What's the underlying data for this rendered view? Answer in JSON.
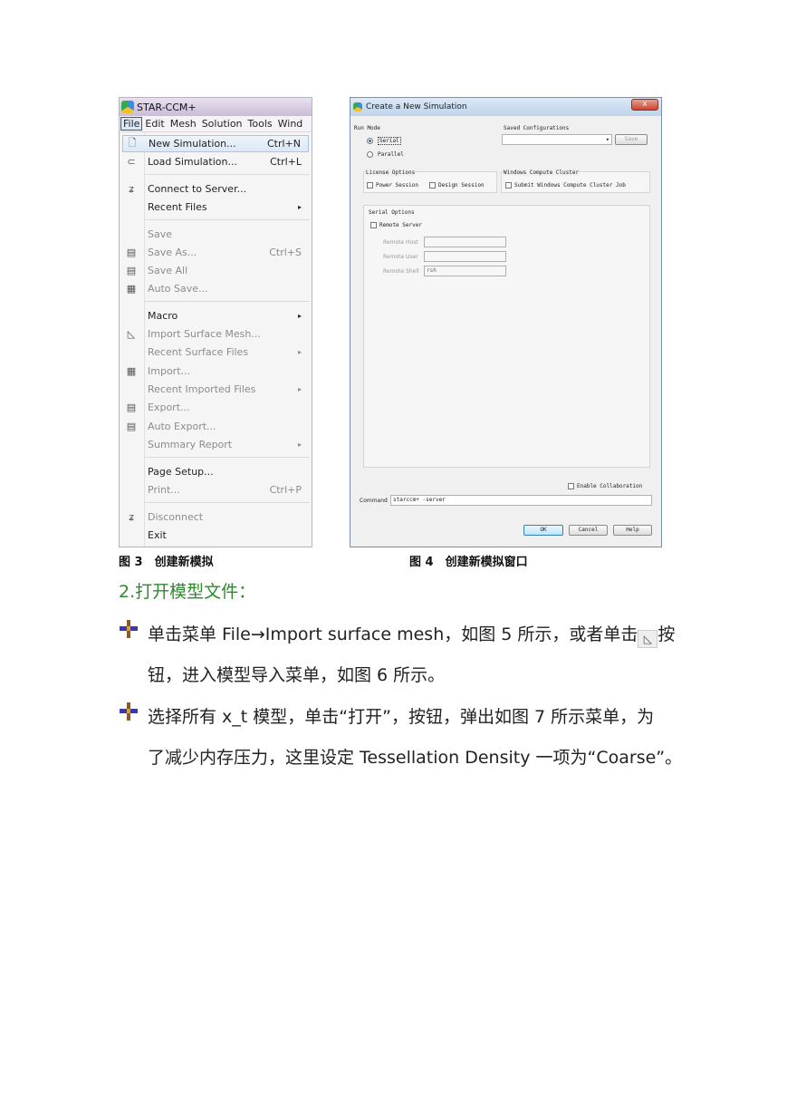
{
  "fig3": {
    "title": "STAR-CCM+",
    "menubar": [
      "File",
      "Edit",
      "Mesh",
      "Solution",
      "Tools",
      "Wind"
    ],
    "items": [
      {
        "label": "New Simulation...",
        "shortcut": "Ctrl+N",
        "icon": "new-sim-icon",
        "glyph": "🗋"
      },
      {
        "label": "Load Simulation...",
        "shortcut": "Ctrl+L",
        "icon": "load-sim-icon",
        "glyph": "⊂"
      },
      {
        "label": "Connect to Server...",
        "icon": "connect-icon",
        "glyph": "ʑ"
      },
      {
        "label": "Recent Files",
        "arrow": "▸"
      },
      {
        "label": "Save"
      },
      {
        "label": "Save As...",
        "shortcut": "Ctrl+S",
        "icon": "save-as-icon",
        "glyph": "▤"
      },
      {
        "label": "Save All",
        "icon": "save-all-icon",
        "glyph": "▤"
      },
      {
        "label": "Auto Save...",
        "icon": "auto-save-icon",
        "glyph": "▦"
      },
      {
        "label": "Macro",
        "arrow": "▸"
      },
      {
        "label": "Import Surface Mesh...",
        "icon": "import-surface-icon",
        "glyph": "◺"
      },
      {
        "label": "Recent Surface Files",
        "arrow": "▸"
      },
      {
        "label": "Import...",
        "icon": "import-icon",
        "glyph": "▦"
      },
      {
        "label": "Recent Imported Files",
        "arrow": "▸"
      },
      {
        "label": "Export...",
        "icon": "export-icon",
        "glyph": "▤"
      },
      {
        "label": "Auto Export...",
        "icon": "auto-export-icon",
        "glyph": "▤"
      },
      {
        "label": "Summary Report",
        "arrow": "▸"
      },
      {
        "label": "Page Setup..."
      },
      {
        "label": "Print...",
        "shortcut": "Ctrl+P"
      },
      {
        "label": "Disconnect",
        "icon": "disconnect-icon",
        "glyph": "ʑ"
      },
      {
        "label": "Exit"
      }
    ]
  },
  "fig4": {
    "title": "Create a New Simulation",
    "close": "x",
    "run_mode": {
      "label": "Run Mode",
      "serial": "Serial",
      "parallel": "Parallel"
    },
    "saved_config": {
      "label": "Saved Configurations",
      "save": "Save",
      "arrow": "▾"
    },
    "license": {
      "label": "License Options",
      "power": "Power Session",
      "design": "Design Session"
    },
    "windows_cluster": {
      "label": "Windows Compute Cluster",
      "submit": "Submit Windows Compute Cluster Job"
    },
    "serial_options": {
      "label": "Serial Options",
      "remote_server": "Remote Server",
      "remote_host": "Remote Host",
      "remote_user": "Remote User",
      "remote_shell": "Remote Shell",
      "shell_value": "rsh"
    },
    "enable_collab": "Enable Collaboration",
    "command_label": "Command",
    "command_value": "starccm+ -server",
    "ok": "OK",
    "cancel": "Cancel",
    "help": "Help"
  },
  "captions": {
    "fig3": "图 3　创建新模拟",
    "fig4": "图 4　创建新模拟窗口"
  },
  "section_title": "2.打开模型文件：",
  "bullet1": {
    "line1a": "单击菜单 File→Import surface mesh，如图 5 所示，或者单击",
    "icon_glyph": "◺",
    "line1b": "按",
    "line2": "钮，进入模型导入菜单，如图 6 所示。"
  },
  "bullet2": {
    "line1": "选择所有 x_t 模型，单击“打开”，按钮，弹出如图 7 所示菜单，为",
    "line2": "了减少内存压力，这里设定 Tessellation Density 一项为“Coarse”。"
  }
}
